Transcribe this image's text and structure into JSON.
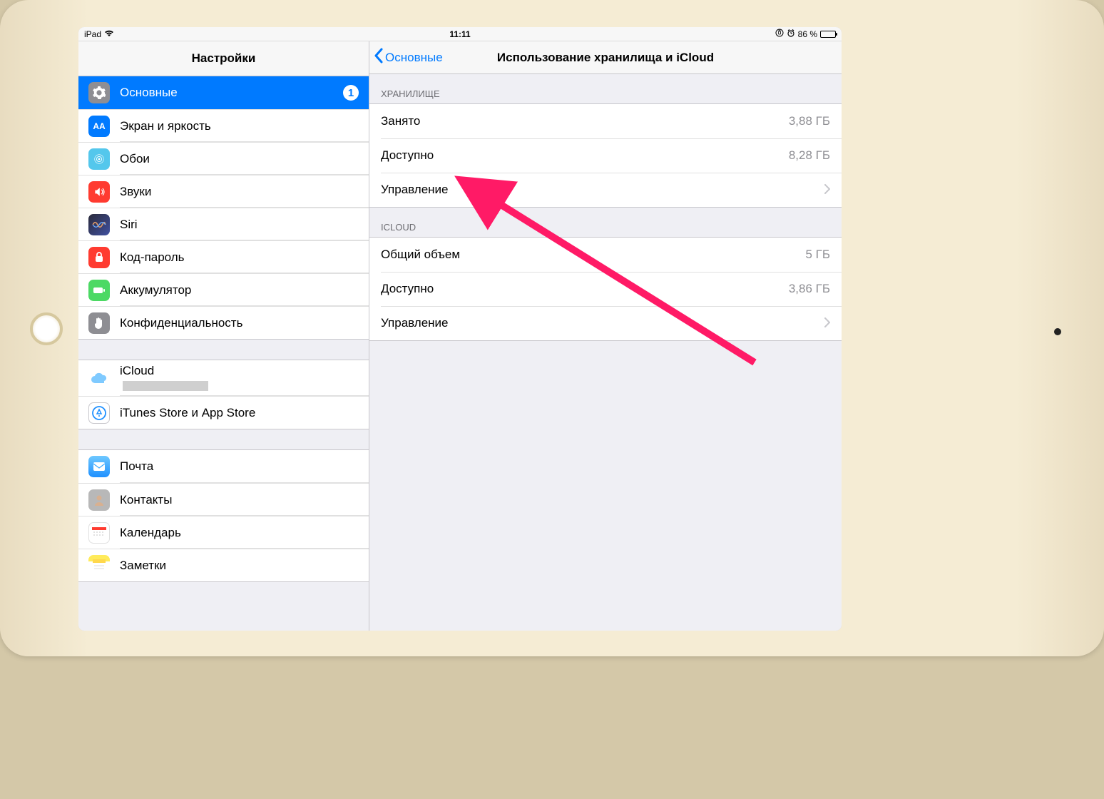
{
  "status": {
    "device": "iPad",
    "time": "11:11",
    "battery_pct": "86 %"
  },
  "sidebar": {
    "title": "Настройки",
    "groupA": [
      {
        "label": "Основные",
        "selected": true,
        "badge": "1"
      },
      {
        "label": "Экран и яркость"
      },
      {
        "label": "Обои"
      },
      {
        "label": "Звуки"
      },
      {
        "label": "Siri"
      },
      {
        "label": "Код-пароль"
      },
      {
        "label": "Аккумулятор"
      },
      {
        "label": "Конфиденциальность"
      }
    ],
    "groupB": [
      {
        "label": "iCloud"
      },
      {
        "label": "iTunes Store и App Store"
      }
    ],
    "groupC": [
      {
        "label": "Почта"
      },
      {
        "label": "Контакты"
      },
      {
        "label": "Календарь"
      },
      {
        "label": "Заметки"
      }
    ]
  },
  "detail": {
    "back_label": "Основные",
    "title": "Использование хранилища и iCloud",
    "storage_header": "ХРАНИЛИЩЕ",
    "storage": [
      {
        "label": "Занято",
        "value": "3,88 ГБ"
      },
      {
        "label": "Доступно",
        "value": "8,28 ГБ"
      },
      {
        "label": "Управление",
        "chevron": true
      }
    ],
    "icloud_header": "ICLOUD",
    "icloud": [
      {
        "label": "Общий объем",
        "value": "5 ГБ"
      },
      {
        "label": "Доступно",
        "value": "3,86 ГБ"
      },
      {
        "label": "Управление",
        "chevron": true
      }
    ]
  }
}
